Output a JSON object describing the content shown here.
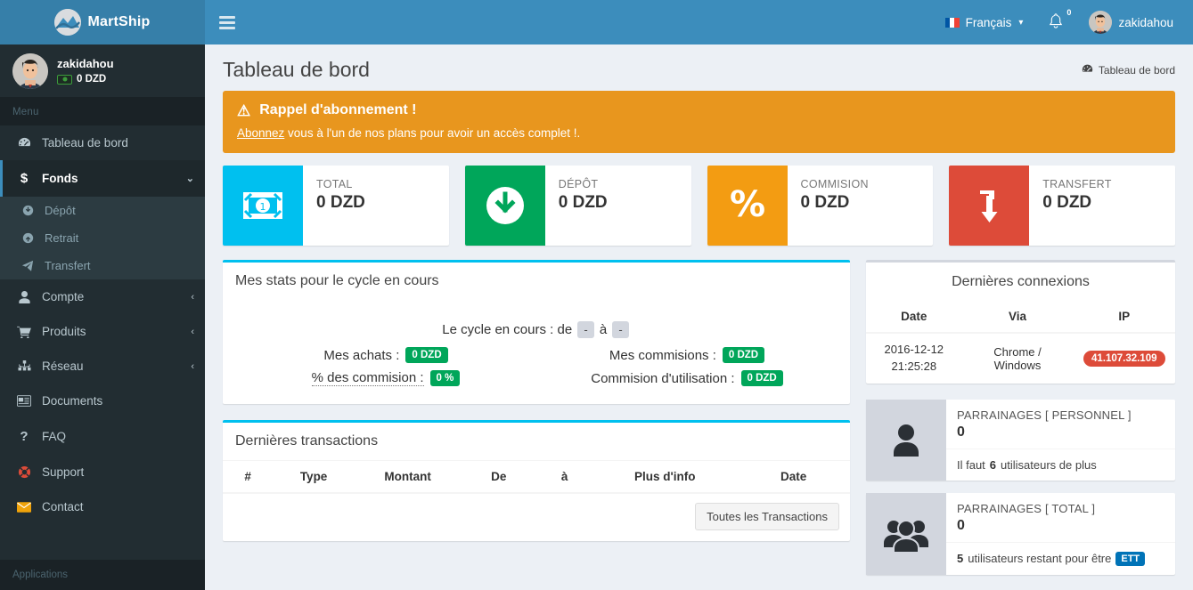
{
  "brand": {
    "name": "MartShip",
    "logo_icon": "mountain-logo-icon"
  },
  "sidebar": {
    "user": {
      "name": "zakidahou",
      "balance": "0 DZD",
      "money_icon": "money-bill-icon"
    },
    "menu_label": "Menu",
    "apps_label": "Applications",
    "items": [
      {
        "label": "Tableau de bord",
        "icon": "dashboard-icon",
        "active": false
      },
      {
        "label": "Fonds",
        "icon": "dollar-icon",
        "active": true,
        "arrow": "⌄"
      },
      {
        "label": "Compte",
        "icon": "user-icon",
        "arrow": "‹"
      },
      {
        "label": "Produits",
        "icon": "cart-icon",
        "arrow": "‹"
      },
      {
        "label": "Réseau",
        "icon": "sitemap-icon",
        "arrow": "‹"
      },
      {
        "label": "Documents",
        "icon": "newspaper-icon"
      },
      {
        "label": "FAQ",
        "icon": "question-icon"
      },
      {
        "label": "Support",
        "icon": "lifering-icon"
      },
      {
        "label": "Contact",
        "icon": "envelope-icon"
      }
    ],
    "submenu": [
      {
        "label": "Dépôt",
        "icon": "arrow-down-circle-icon"
      },
      {
        "label": "Retrait",
        "icon": "arrow-up-circle-icon"
      },
      {
        "label": "Transfert",
        "icon": "paper-plane-icon"
      }
    ]
  },
  "navbar": {
    "menu_toggle": "hamburger-icon",
    "language": "Français",
    "language_flag": "france-flag-icon",
    "notifications_count": "0",
    "notifications_icon": "bell-icon",
    "user": "zakidahou"
  },
  "header": {
    "title": "Tableau de bord",
    "breadcrumb": "Tableau de bord",
    "breadcrumb_icon": "dashboard-icon"
  },
  "alert": {
    "icon": "warning-triangle-icon",
    "title": "Rappel d'abonnement !",
    "link_text": "Abonnez",
    "body_rest": " vous à l'un de nos plans pour avoir un accès complet !.",
    "color": "#e8961e"
  },
  "stat_boxes": [
    {
      "label": "TOTAL",
      "value": "0 DZD",
      "color": "#00c0ef",
      "icon": "money-bill-icon"
    },
    {
      "label": "DÉPÔT",
      "value": "0 DZD",
      "color": "#00a65a",
      "icon": "arrow-down-circle-icon"
    },
    {
      "label": "COMMISION",
      "value": "0 DZD",
      "color": "#f39c12",
      "icon": "percent-icon"
    },
    {
      "label": "TRANSFERT",
      "value": "0 DZD",
      "color": "#dd4b39",
      "icon": "transfer-arrow-icon"
    }
  ],
  "stats_panel": {
    "title": "Mes stats pour le cycle en cours",
    "cycle_prefix": "Le cycle en cours : de",
    "cycle_from": "-",
    "cycle_middle": "à",
    "cycle_to": "-",
    "rows": [
      {
        "label": "Mes achats :",
        "value": "0 DZD",
        "dotted": false
      },
      {
        "label": "Mes commisions :",
        "value": "0 DZD",
        "dotted": false
      },
      {
        "label": "% des commision :",
        "value": "0 %",
        "dotted": true
      },
      {
        "label": "Commision d'utilisation :",
        "value": "0 DZD",
        "dotted": false
      }
    ]
  },
  "transactions": {
    "title": "Dernières transactions",
    "columns": [
      "#",
      "Type",
      "Montant",
      "De",
      "à",
      "Plus d'info",
      "Date"
    ],
    "rows": [],
    "all_button": "Toutes les Transactions"
  },
  "connections": {
    "title": "Dernières connexions",
    "columns": [
      "Date",
      "Via",
      "IP"
    ],
    "rows": [
      {
        "date": "2016-12-12 21:25:28",
        "via": "Chrome / Windows",
        "ip": "41.107.32.109"
      }
    ]
  },
  "referrals": [
    {
      "icon": "single-user-icon",
      "label": "PARRAINAGES [ PERSONNEL ]",
      "number": "0",
      "foot_prefix": "Il faut ",
      "foot_strong": "6",
      "foot_suffix": " utilisateurs de plus",
      "badge": ""
    },
    {
      "icon": "group-users-icon",
      "label": "PARRAINAGES [ TOTAL ]",
      "number": "0",
      "foot_prefix": "",
      "foot_strong": "5",
      "foot_suffix": " utilisateurs restant pour être",
      "badge": "ETT"
    }
  ]
}
